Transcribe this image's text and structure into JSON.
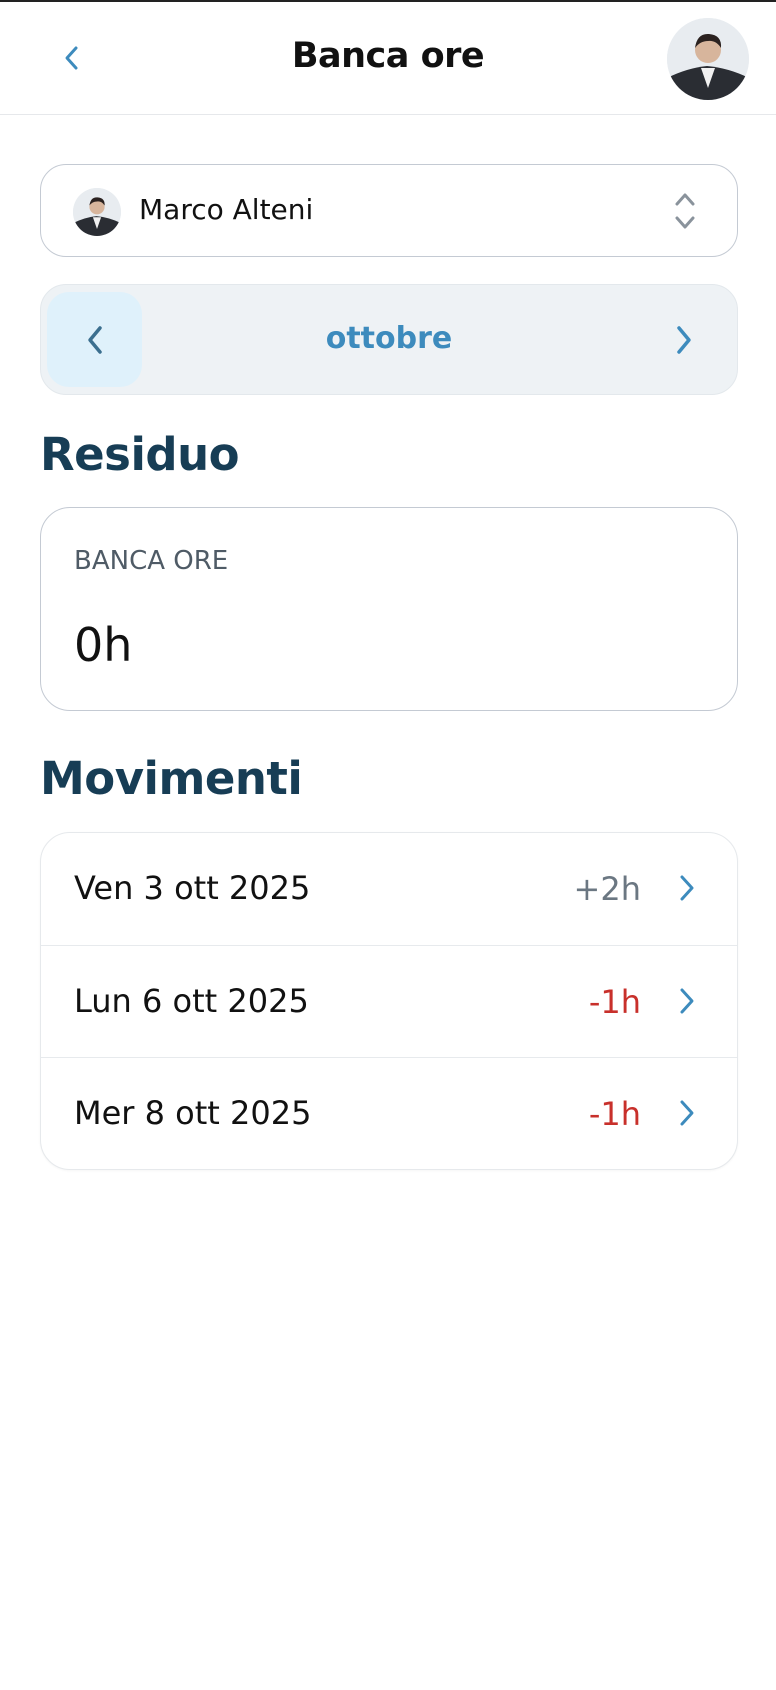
{
  "header": {
    "title": "Banca ore",
    "back_icon": "chevron-left-icon",
    "avatar_icon": "user-avatar"
  },
  "user_select": {
    "name": "Marco Alteni",
    "icon": "chevron-up-down-icon"
  },
  "month_nav": {
    "label": "ottobre",
    "prev_icon": "chevron-left-icon",
    "next_icon": "chevron-right-icon"
  },
  "residuo": {
    "title": "Residuo",
    "card_label": "BANCA ORE",
    "card_value": "0h"
  },
  "movimenti": {
    "title": "Movimenti",
    "rows": [
      {
        "date": "Ven 3 ott 2025",
        "amount": "+2h",
        "color": "#6b7782"
      },
      {
        "date": "Lun 6 ott 2025",
        "amount": "-1h",
        "color": "#c8302b"
      },
      {
        "date": "Mer 8 ott 2025",
        "amount": "-1h",
        "color": "#c8302b"
      }
    ]
  },
  "colors": {
    "accent": "#3d8bbd",
    "section_title": "#173d55",
    "negative": "#c8302b",
    "positive": "#6b7782"
  }
}
